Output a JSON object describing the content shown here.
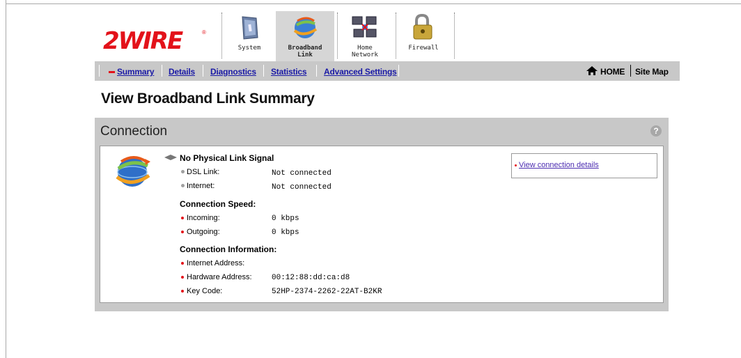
{
  "brand": {
    "logo_text": "2WIRE",
    "registered": "®"
  },
  "tabs": [
    {
      "line1": "System",
      "line2": "",
      "icon": "system-icon"
    },
    {
      "line1": "Broadband",
      "line2": "Link",
      "icon": "broadband-link-icon",
      "active": true
    },
    {
      "line1": "Home",
      "line2": "Network",
      "icon": "home-network-icon"
    },
    {
      "line1": "Firewall",
      "line2": "",
      "icon": "firewall-lock-icon"
    }
  ],
  "subnav": {
    "items": [
      "Summary",
      "Details",
      "Diagnostics",
      "Statistics",
      "Advanced Settings"
    ],
    "active": "Summary",
    "home": "HOME",
    "sitemap": "Site Map"
  },
  "page_title": "View Broadband Link Summary",
  "panel": {
    "title": "Connection",
    "help": "?",
    "status": "No Physical Link Signal",
    "link_rows": [
      {
        "label": "DSL Link:",
        "value": "Not connected"
      },
      {
        "label": "Internet:",
        "value": "Not connected"
      }
    ],
    "speed_heading": "Connection Speed:",
    "speed_rows": [
      {
        "label": "Incoming:",
        "value": "0 kbps"
      },
      {
        "label": "Outgoing:",
        "value": "0 kbps"
      }
    ],
    "info_heading": "Connection Information:",
    "info_rows": [
      {
        "label": "Internet Address:",
        "value": ""
      },
      {
        "label": "Hardware Address:",
        "value": "00:12:88:dd:ca:d8"
      },
      {
        "label": "Key Code:",
        "value": "52HP-2374-2262-22AT-B2KR"
      }
    ],
    "details_link": "View connection details"
  },
  "colors": {
    "brand_red": "#e3121a",
    "nav_gray": "#c8c8c8",
    "link_blue": "#1a1aa6"
  }
}
